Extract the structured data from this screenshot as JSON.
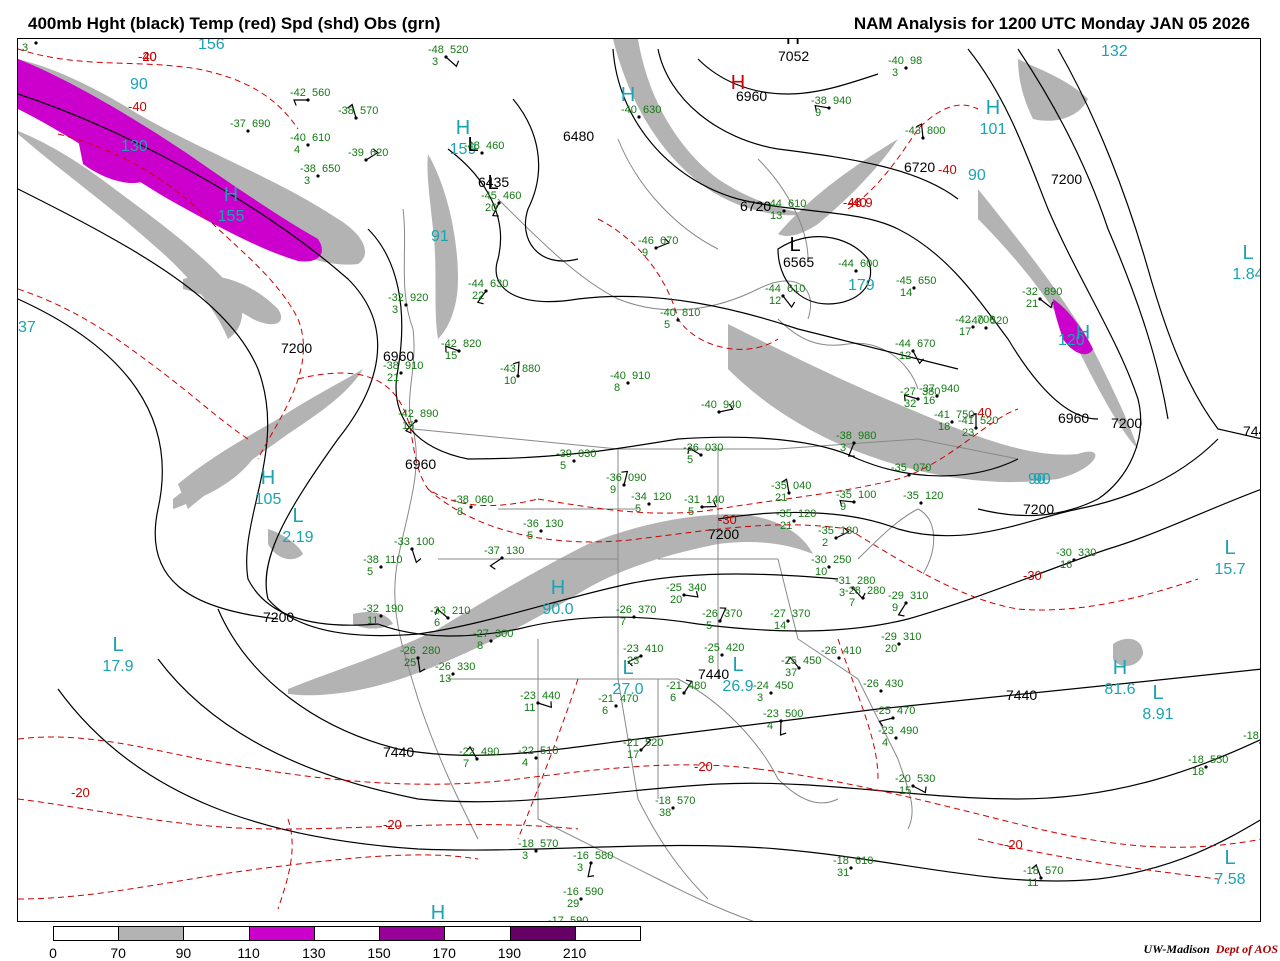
{
  "header": {
    "left": "400mb Hght (black) Temp (red) Spd (shd) Obs (grn)",
    "right": "NAM Analysis for 1200 UTC Monday  JAN 05 2026"
  },
  "colors": {
    "height_contour": "#000000",
    "temp_contour": "#cc0000",
    "speed_label": "#1aa3b3",
    "obs": "#117a11",
    "borders": "#888888",
    "shade_70": "#b3b3b3",
    "shade_110": "#cc00cc",
    "shade_150": "#990099",
    "shade_190": "#660066"
  },
  "legend": {
    "labels": [
      "0",
      "70",
      "90",
      "110",
      "130",
      "150",
      "170",
      "190",
      "210"
    ],
    "fills": [
      "#ffffff",
      "#b3b3b3",
      "#ffffff",
      "#cc00cc",
      "#ffffff",
      "#990099",
      "#ffffff",
      "#660066",
      "#ffffff"
    ]
  },
  "credit": {
    "org": "UW-Madison",
    "dept": "Dept of AOS"
  },
  "height_labels": [
    {
      "text": "7052"
    },
    {
      "text": "6960"
    },
    {
      "text": "6480"
    },
    {
      "text": "6435"
    },
    {
      "text": "6720"
    },
    {
      "text": "6720"
    },
    {
      "text": "6565"
    },
    {
      "text": "7200"
    },
    {
      "text": "7200"
    },
    {
      "text": "6960"
    },
    {
      "text": "6960"
    },
    {
      "text": "6960"
    },
    {
      "text": "7200"
    },
    {
      "text": "7200"
    },
    {
      "text": "7200"
    },
    {
      "text": "7200"
    },
    {
      "text": "744"
    },
    {
      "text": "7440"
    },
    {
      "text": "7440"
    },
    {
      "text": "7440"
    }
  ],
  "temp_labels": [
    {
      "text": "-40"
    },
    {
      "text": "-40"
    },
    {
      "text": "-40"
    },
    {
      "text": "-40"
    },
    {
      "text": "-46.9"
    },
    {
      "text": "-40"
    },
    {
      "text": "-30"
    },
    {
      "text": "-30"
    },
    {
      "text": "-20"
    },
    {
      "text": "-20"
    },
    {
      "text": "-20"
    },
    {
      "text": "-20"
    },
    {
      "text": "-20"
    }
  ],
  "pressure_centers": [
    {
      "letter": "H",
      "value": "155",
      "color": "speed"
    },
    {
      "letter": "H",
      "value": "159",
      "color": "speed"
    },
    {
      "letter": "H",
      "value": "",
      "color": "speed"
    },
    {
      "letter": "H",
      "value": "101",
      "color": "speed"
    },
    {
      "letter": "H",
      "value": "105",
      "color": "speed"
    },
    {
      "letter": "L",
      "value": "2.19",
      "color": "speed"
    },
    {
      "letter": "H",
      "value": "90.0",
      "color": "speed"
    },
    {
      "letter": "L",
      "value": "27.0",
      "color": "speed"
    },
    {
      "letter": "L",
      "value": "26.9",
      "color": "speed"
    },
    {
      "letter": "L",
      "value": "17.9",
      "color": "speed"
    },
    {
      "letter": "L",
      "value": "15.7",
      "color": "speed"
    },
    {
      "letter": "L",
      "value": "1.84",
      "color": "speed"
    },
    {
      "letter": "H",
      "value": "81.6",
      "color": "speed"
    },
    {
      "letter": "L",
      "value": "8.91",
      "color": "speed"
    },
    {
      "letter": "H",
      "value": "16.4",
      "color": "speed"
    },
    {
      "letter": "L",
      "value": "7.58",
      "color": "speed"
    },
    {
      "letter": "L",
      "value": "",
      "color": "height"
    },
    {
      "letter": "H",
      "value": "",
      "color": "temp"
    },
    {
      "letter": "H",
      "value": "",
      "color": "speed"
    },
    {
      "letter": "L",
      "value": "",
      "color": "height"
    },
    {
      "letter": "L",
      "value": "",
      "color": "height"
    },
    {
      "letter": "H",
      "value": "",
      "color": "height"
    }
  ],
  "speed_values": [
    {
      "text": "156"
    },
    {
      "text": "90"
    },
    {
      "text": "130"
    },
    {
      "text": "132"
    },
    {
      "text": "90"
    },
    {
      "text": "120"
    },
    {
      "text": "90"
    },
    {
      "text": "90"
    },
    {
      "text": "37"
    },
    {
      "text": "179"
    },
    {
      "text": "91"
    }
  ],
  "observations": [
    {
      "temp": "-42",
      "hgt": "560",
      "dew": ""
    },
    {
      "temp": "-37",
      "hgt": "690",
      "dew": ""
    },
    {
      "temp": "-38",
      "hgt": "570",
      "dew": ""
    },
    {
      "temp": "-40",
      "hgt": "610",
      "dew": "4"
    },
    {
      "temp": "-39",
      "hgt": "620",
      "dew": ""
    },
    {
      "temp": "-38",
      "hgt": "650",
      "dew": "3"
    },
    {
      "temp": "-48",
      "hgt": "520",
      "dew": "3"
    },
    {
      "temp": "-48",
      "hgt": "460",
      "dew": ""
    },
    {
      "temp": "-45",
      "hgt": "460",
      "dew": "20"
    },
    {
      "temp": "-40",
      "hgt": "630",
      "dew": ""
    },
    {
      "temp": "-38",
      "hgt": "940",
      "dew": "9"
    },
    {
      "temp": "-40",
      "hgt": "98",
      "dew": "3"
    },
    {
      "temp": "-43",
      "hgt": "800",
      "dew": ""
    },
    {
      "temp": "-44",
      "hgt": "610",
      "dew": "13"
    },
    {
      "temp": "-46",
      "hgt": "670",
      "dew": "9"
    },
    {
      "temp": "-44",
      "hgt": "600",
      "dew": ""
    },
    {
      "temp": "-44",
      "hgt": "610",
      "dew": "12"
    },
    {
      "temp": "-45",
      "hgt": "650",
      "dew": "14"
    },
    {
      "temp": "-44",
      "hgt": "630",
      "dew": "22"
    },
    {
      "temp": "-32",
      "hgt": "920",
      "dew": "3"
    },
    {
      "temp": "-42",
      "hgt": "820",
      "dew": "15"
    },
    {
      "temp": "-40",
      "hgt": "810",
      "dew": "5"
    },
    {
      "temp": "-43",
      "hgt": "880",
      "dew": "10"
    },
    {
      "temp": "-40",
      "hgt": "910",
      "dew": "8"
    },
    {
      "temp": "-40",
      "hgt": "940",
      "dew": ""
    },
    {
      "temp": "-42",
      "hgt": "700",
      "dew": "17"
    },
    {
      "temp": "-44",
      "hgt": "670",
      "dew": "12"
    },
    {
      "temp": "-38",
      "hgt": "910",
      "dew": "21"
    },
    {
      "temp": "-42",
      "hgt": "890",
      "dew": "15"
    },
    {
      "temp": "-39",
      "hgt": "030",
      "dew": "5"
    },
    {
      "temp": "-36",
      "hgt": "030",
      "dew": "5"
    },
    {
      "temp": "-38",
      "hgt": "060",
      "dew": "8"
    },
    {
      "temp": "-36",
      "hgt": "090",
      "dew": "9"
    },
    {
      "temp": "-34",
      "hgt": "120",
      "dew": "5"
    },
    {
      "temp": "-31",
      "hgt": "140",
      "dew": "5"
    },
    {
      "temp": "-36",
      "hgt": "130",
      "dew": "5"
    },
    {
      "temp": "-33",
      "hgt": "100",
      "dew": ""
    },
    {
      "temp": "-38",
      "hgt": "110",
      "dew": "5"
    },
    {
      "temp": "-37",
      "hgt": "130",
      "dew": ""
    },
    {
      "temp": "-32",
      "hgt": "190",
      "dew": "11"
    },
    {
      "temp": "-33",
      "hgt": "210",
      "dew": "6"
    },
    {
      "temp": "-26",
      "hgt": "370",
      "dew": "7"
    },
    {
      "temp": "-26",
      "hgt": "370",
      "dew": "5"
    },
    {
      "temp": "-27",
      "hgt": "370",
      "dew": "14"
    },
    {
      "temp": "-25",
      "hgt": "340",
      "dew": "20"
    },
    {
      "temp": "-27",
      "hgt": "300",
      "dew": "8"
    },
    {
      "temp": "-26",
      "hgt": "280",
      "dew": "25"
    },
    {
      "temp": "-26",
      "hgt": "330",
      "dew": "13"
    },
    {
      "temp": "-23",
      "hgt": "410",
      "dew": "23"
    },
    {
      "temp": "-25",
      "hgt": "420",
      "dew": "8"
    },
    {
      "temp": "-25",
      "hgt": "450",
      "dew": "37"
    },
    {
      "temp": "-26",
      "hgt": "410",
      "dew": ""
    },
    {
      "temp": "-21",
      "hgt": "480",
      "dew": "6"
    },
    {
      "temp": "-21",
      "hgt": "470",
      "dew": "6"
    },
    {
      "temp": "-23",
      "hgt": "440",
      "dew": "11"
    },
    {
      "temp": "-24",
      "hgt": "450",
      "dew": "3"
    },
    {
      "temp": "-23",
      "hgt": "500",
      "dew": "4"
    },
    {
      "temp": "-26",
      "hgt": "430",
      "dew": ""
    },
    {
      "temp": "-25",
      "hgt": "470",
      "dew": ""
    },
    {
      "temp": "-23",
      "hgt": "490",
      "dew": "4"
    },
    {
      "temp": "-22",
      "hgt": "490",
      "dew": "7"
    },
    {
      "temp": "-22",
      "hgt": "510",
      "dew": "4"
    },
    {
      "temp": "-21",
      "hgt": "520",
      "dew": "17"
    },
    {
      "temp": "-18",
      "hgt": "570",
      "dew": "38"
    },
    {
      "temp": "-20",
      "hgt": "530",
      "dew": "15"
    },
    {
      "temp": "-18",
      "hgt": "570",
      "dew": "3"
    },
    {
      "temp": "-16",
      "hgt": "580",
      "dew": "3"
    },
    {
      "temp": "-16",
      "hgt": "590",
      "dew": "29"
    },
    {
      "temp": "-17",
      "hgt": "590",
      "dew": ""
    },
    {
      "temp": "-18",
      "hgt": "610",
      "dew": "31"
    },
    {
      "temp": "-18",
      "hgt": "570",
      "dew": "11"
    },
    {
      "temp": "-18",
      "hgt": "550",
      "dew": "18"
    },
    {
      "temp": "-18",
      "hgt": "5",
      "dew": ""
    },
    {
      "temp": "-30",
      "hgt": "330",
      "dew": "16"
    },
    {
      "temp": "-32",
      "hgt": "890",
      "dew": "21"
    },
    {
      "temp": "-37",
      "hgt": "940",
      "dew": "16"
    },
    {
      "temp": "-38",
      "hgt": "980",
      "dew": "3"
    },
    {
      "temp": "-35",
      "hgt": "070",
      "dew": ""
    },
    {
      "temp": "-35",
      "hgt": "100",
      "dew": "9"
    },
    {
      "temp": "-35",
      "hgt": "120",
      "dew": ""
    },
    {
      "temp": "-35",
      "hgt": "040",
      "dew": "21"
    },
    {
      "temp": "-35",
      "hgt": "120",
      "dew": "21"
    },
    {
      "temp": "-35",
      "hgt": "180",
      "dew": "2"
    },
    {
      "temp": "-30",
      "hgt": "250",
      "dew": "10"
    },
    {
      "temp": "-31",
      "hgt": "280",
      "dew": "3"
    },
    {
      "temp": "-28",
      "hgt": "280",
      "dew": "7"
    },
    {
      "temp": "-29",
      "hgt": "310",
      "dew": "9"
    },
    {
      "temp": "-29",
      "hgt": "310",
      "dew": "20"
    },
    {
      "temp": "-27",
      "hgt": "380",
      "dew": "32"
    },
    {
      "temp": "-41",
      "hgt": "750",
      "dew": "18"
    },
    {
      "temp": "-41",
      "hgt": "520",
      "dew": "23"
    },
    {
      "temp": "-40",
      "hgt": "520",
      "dew": ""
    },
    {
      "temp": "-42",
      "hgt": "720",
      "dew": "3"
    }
  ]
}
